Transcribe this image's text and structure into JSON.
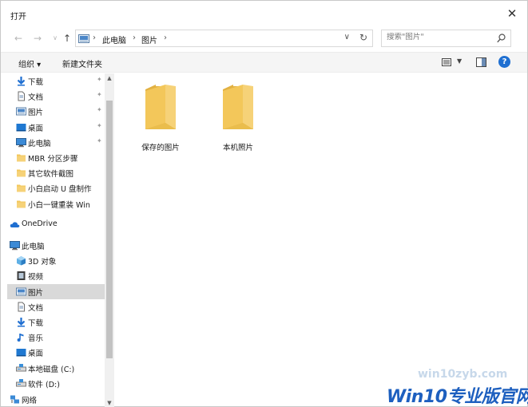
{
  "window": {
    "title": "打开",
    "close_glyph": "✕"
  },
  "address": {
    "crumbs": [
      "此电脑",
      "图片"
    ],
    "separator": "›",
    "search_placeholder": "搜索\"图片\""
  },
  "toolbar": {
    "organize": "组织 ▾",
    "new_folder": "新建文件夹",
    "help": "?"
  },
  "sidebar": {
    "quick_access": [
      {
        "label": "下载",
        "icon": "download-icon",
        "pinned": true
      },
      {
        "label": "文档",
        "icon": "document-icon",
        "pinned": true
      },
      {
        "label": "图片",
        "icon": "pictures-icon",
        "pinned": true
      },
      {
        "label": "桌面",
        "icon": "desktop-icon",
        "pinned": true
      },
      {
        "label": "此电脑",
        "icon": "computer-icon",
        "pinned": true
      },
      {
        "label": "MBR 分区步骤",
        "icon": "folder-icon",
        "pinned": false
      },
      {
        "label": "其它软件截图",
        "icon": "folder-icon",
        "pinned": false
      },
      {
        "label": "小白启动 U 盘制作",
        "icon": "folder-icon",
        "pinned": false
      },
      {
        "label": "小白一键重装 Win",
        "icon": "folder-icon",
        "pinned": false
      }
    ],
    "onedrive": "OneDrive",
    "this_pc": "此电脑",
    "this_pc_items": [
      {
        "label": "3D 对象",
        "icon": "3d-objects-icon"
      },
      {
        "label": "视频",
        "icon": "video-icon"
      },
      {
        "label": "图片",
        "icon": "pictures-icon",
        "selected": true
      },
      {
        "label": "文档",
        "icon": "document-icon"
      },
      {
        "label": "下载",
        "icon": "download-icon"
      },
      {
        "label": "音乐",
        "icon": "music-icon"
      },
      {
        "label": "桌面",
        "icon": "desktop-icon"
      },
      {
        "label": "本地磁盘 (C:)",
        "icon": "drive-icon"
      },
      {
        "label": "软件 (D:)",
        "icon": "drive-icon"
      }
    ],
    "network": "网络",
    "pin_glyph": "📌"
  },
  "content": {
    "folders": [
      {
        "name": "保存的图片"
      },
      {
        "name": "本机照片"
      }
    ]
  },
  "watermark": {
    "url": "win10zyb.com",
    "logo": "Win10专业版官网"
  },
  "colors": {
    "folder": "#f3c75a",
    "folder_dark": "#e2b142",
    "accent": "#1f6fd1",
    "selected": "#d9d9d9"
  }
}
